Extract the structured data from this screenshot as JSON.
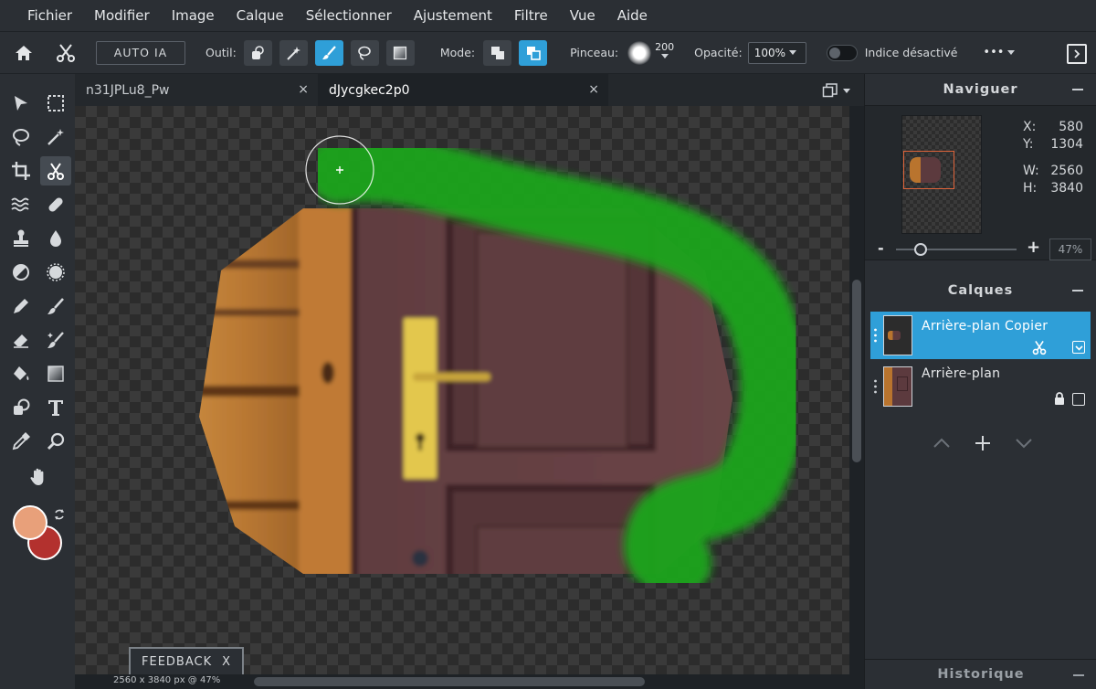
{
  "menu": [
    "Fichier",
    "Modifier",
    "Image",
    "Calque",
    "Sélectionner",
    "Ajustement",
    "Filtre",
    "Vue",
    "Aide"
  ],
  "toolbar": {
    "auto_ia": "AUTO IA",
    "outil_label": "Outil:",
    "mode_label": "Mode:",
    "pinceau_label": "Pinceau:",
    "brush_size": "200",
    "opacite_label": "Opacité:",
    "opacite_value": "100%",
    "indice": "Indice désactivé",
    "more": "•••"
  },
  "tabs": [
    {
      "label": "n31JPLu8_Pw",
      "close": "×"
    },
    {
      "label": "dJycgkec2p0",
      "close": "×"
    }
  ],
  "feedback": {
    "label": "FEEDBACK",
    "close": "X"
  },
  "status": "2560 x 3840 px @ 47%",
  "navigator": {
    "title": "Naviguer",
    "x_label": "X:",
    "x_value": "580",
    "y_label": "Y:",
    "y_value": "1304",
    "w_label": "W:",
    "w_value": "2560",
    "h_label": "H:",
    "h_value": "3840",
    "zoom_minus": "-",
    "zoom_plus": "+",
    "zoom_value": "47%"
  },
  "layers": {
    "title": "Calques",
    "items": [
      {
        "name": "Arrière-plan Copier",
        "selected": true
      },
      {
        "name": "Arrière-plan",
        "selected": false
      }
    ]
  },
  "history": {
    "title": "Historique"
  },
  "colors": {
    "accent": "#2f9fd8",
    "foreground": "#e8a07a",
    "background": "#b3312e",
    "mask": "#1fa51f"
  }
}
